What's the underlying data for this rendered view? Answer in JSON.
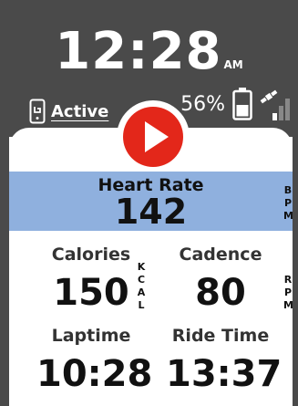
{
  "header": {
    "time": "12:28",
    "ampm": "AM",
    "connection_label": "Active",
    "battery_percent": "56%",
    "icons": [
      "phone-icon",
      "battery-icon",
      "gps-satellite-icon",
      "signal-bars-icon"
    ]
  },
  "controls": {
    "play_icon": "play-icon"
  },
  "heart_rate": {
    "label": "Heart Rate",
    "value": "142",
    "unit": [
      "B",
      "P",
      "M"
    ]
  },
  "metrics": {
    "calories": {
      "label": "Calories",
      "value": "150",
      "unit": [
        "K",
        "C",
        "A",
        "L"
      ]
    },
    "cadence": {
      "label": "Cadence",
      "value": "80",
      "unit": [
        "R",
        "P",
        "M"
      ]
    },
    "laptime": {
      "label": "Laptime",
      "value": "10:28"
    },
    "ride_time": {
      "label": "Ride Time",
      "value": "13:37"
    }
  },
  "colors": {
    "header_bg": "#4a4a4a",
    "hr_band": "#8fb0de",
    "play_red": "#e3271a",
    "text": "#111111"
  }
}
